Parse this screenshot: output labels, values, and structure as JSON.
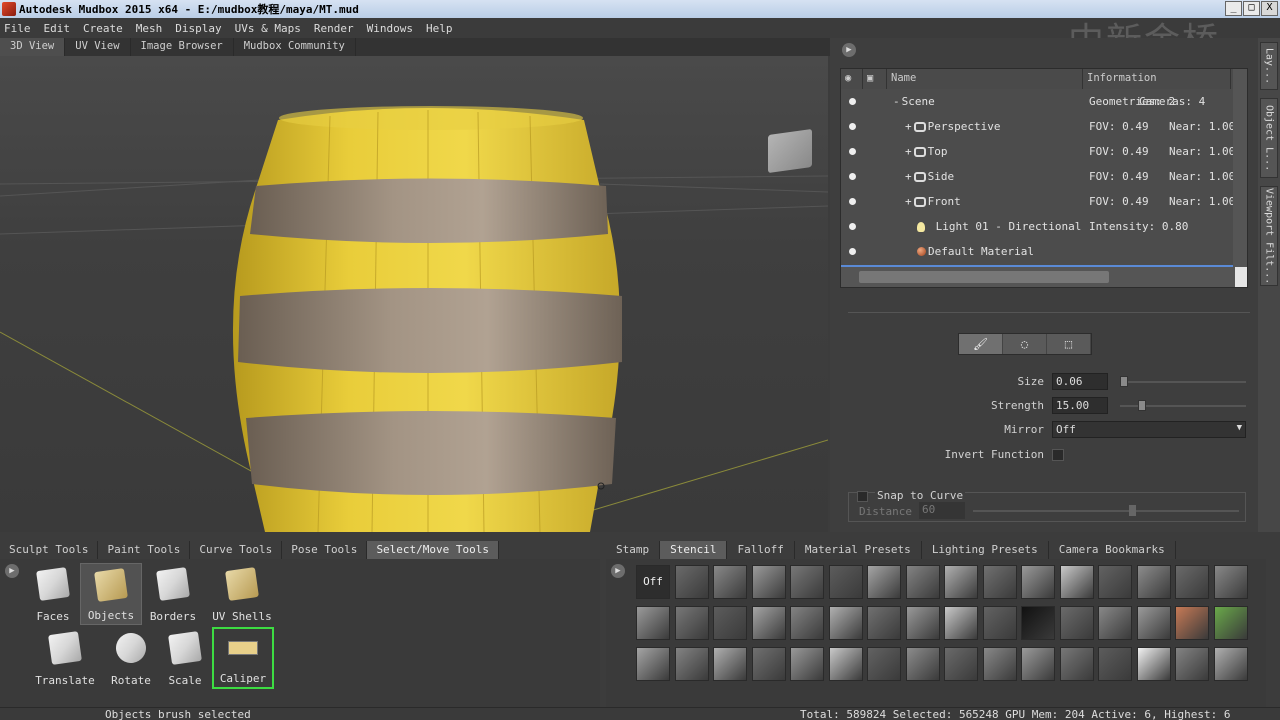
{
  "window": {
    "title": "Autodesk Mudbox 2015 x64 - E:/mudbox教程/maya/MT.mud",
    "minimize": "_",
    "maximize": "□",
    "close": "X"
  },
  "watermark": "中新金桥",
  "menu": [
    "File",
    "Edit",
    "Create",
    "Mesh",
    "Display",
    "UVs & Maps",
    "Render",
    "Windows",
    "Help"
  ],
  "view_tabs": [
    "3D View",
    "UV View",
    "Image Browser",
    "Mudbox Community"
  ],
  "outliner": {
    "col_name": "Name",
    "col_info": "Information",
    "rows": [
      {
        "name": "Scene",
        "info1": "Geometries: 2",
        "info2": "Cameras: 4",
        "icon": "tree-expand-icon"
      },
      {
        "name": "Perspective",
        "info1": "FOV: 0.49",
        "info2": "Near: 1.000",
        "icon": "camera-icon"
      },
      {
        "name": "Top",
        "info1": "FOV: 0.49",
        "info2": "Near: 1.000",
        "icon": "camera-icon"
      },
      {
        "name": "Side",
        "info1": "FOV: 0.49",
        "info2": "Near: 1.000",
        "icon": "camera-icon"
      },
      {
        "name": "Front",
        "info1": "FOV: 0.49",
        "info2": "Near: 1.000",
        "icon": "camera-icon"
      },
      {
        "name": "Light 01 - Directional",
        "info1": "Intensity: 0.80",
        "info2": "",
        "icon": "light-bulb-icon"
      },
      {
        "name": "Default Material",
        "info1": "",
        "info2": "",
        "icon": "material-sphere-icon"
      }
    ]
  },
  "brush_props": {
    "size_label": "Size",
    "size_value": "0.06",
    "size_fraction": 0.0,
    "strength_label": "Strength",
    "strength_value": "15.00",
    "strength_fraction": 0.15,
    "mirror_label": "Mirror",
    "mirror_value": "Off",
    "invert_label": "Invert Function",
    "snap_label": "Snap to Curve",
    "distance_label": "Distance",
    "distance_value": "60"
  },
  "side_dock": [
    "Lay...",
    "Object L...",
    "Viewport Filt..."
  ],
  "tray_tabs": [
    "Sculpt Tools",
    "Paint Tools",
    "Curve Tools",
    "Pose Tools",
    "Select/Move Tools"
  ],
  "tools": [
    "Faces",
    "Objects",
    "Borders",
    "UV Shells",
    "Translate",
    "Rotate",
    "Scale",
    "Caliper"
  ],
  "stencil_tabs": [
    "Stamp",
    "Stencil",
    "Falloff",
    "Material Presets",
    "Lighting Presets",
    "Camera Bookmarks"
  ],
  "stencil_off": "Off",
  "status": {
    "message": "Objects brush selected",
    "stats": "Total: 589824  Selected: 565248 GPU Mem: 204  Active: 6, Highest: 6"
  },
  "colors": {
    "barrel": "#e6c832",
    "hoop": "#8a7a6a",
    "accent_green": "#3ddc42"
  }
}
